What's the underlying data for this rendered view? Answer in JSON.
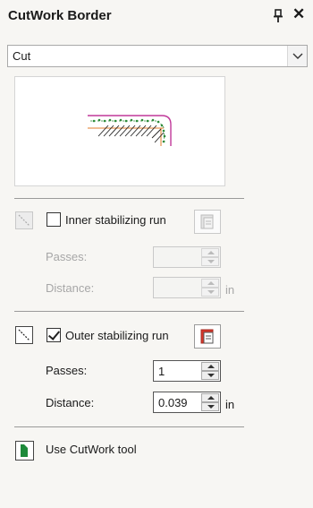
{
  "window": {
    "title": "CutWork Border"
  },
  "type_select": {
    "value": "Cut"
  },
  "inner_run": {
    "label": "Inner stabilizing run",
    "checked": false,
    "enabled": false,
    "passes_label": "Passes:",
    "passes_value": "",
    "distance_label": "Distance:",
    "distance_value": "",
    "unit": "in"
  },
  "outer_run": {
    "label": "Outer stabilizing run",
    "checked": true,
    "enabled": true,
    "passes_label": "Passes:",
    "passes_value": "1",
    "distance_label": "Distance:",
    "distance_value": "0.039",
    "unit": "in"
  },
  "cutwork_tool": {
    "label": "Use CutWork tool"
  },
  "icons": {
    "pin": "pin-icon",
    "close": "close-icon",
    "dropdown": "chevron-down-icon",
    "inner_run_icon": "diagonal-run-icon",
    "outer_run_icon": "diagonal-run-icon",
    "properties": "properties-icon",
    "cutwork_tool": "cutwork-tool-icon"
  },
  "colors": {
    "preview_outline": "#c0399a",
    "preview_stitch": "#2e8b3a",
    "preview_run": "#e07b2a",
    "properties_accent": "#d8372a",
    "cutwork_tool_accent": "#1d8a3a"
  }
}
